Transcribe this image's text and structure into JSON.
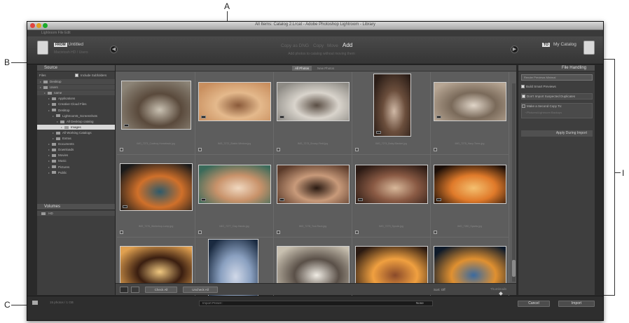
{
  "callouts": {
    "a": "A",
    "b": "B",
    "c": "C",
    "i": "I"
  },
  "window": {
    "title": "All Items: Catalog 2.Lrcat - Adobe Photoshop Lightroom - Library",
    "menu": "Lightroom   File   Edit"
  },
  "header": {
    "source_tag": "FROM",
    "source_name": "Untitled",
    "source_sub": "Macintosh HD / Users",
    "modes": [
      "Copy as DNG",
      "Copy",
      "Move",
      "Add"
    ],
    "active_mode_index": 3,
    "mode_subtitle": "Add photos to catalog without moving them",
    "dest_tag": "TO",
    "dest_name": "My Catalog"
  },
  "left_panel": {
    "header": "Source",
    "toolbar_left": "Files",
    "toolbar_right": "Include Subfolders",
    "tree": [
      {
        "label": "Desktop",
        "level": 0,
        "band": true
      },
      {
        "label": "Users",
        "level": 0,
        "band": true
      },
      {
        "label": "name",
        "level": 1,
        "band": true
      },
      {
        "label": "Applications",
        "level": 2
      },
      {
        "label": "Creative Cloud Files",
        "level": 2
      },
      {
        "label": "Desktop",
        "level": 2
      },
      {
        "label": "Lightroom5_Screenshots",
        "level": 3
      },
      {
        "label": "All Desktop catalog",
        "level": 4
      },
      {
        "label": "Images",
        "level": 5,
        "selected": true
      },
      {
        "label": "All Working Catalogs",
        "level": 3
      },
      {
        "label": "Extras",
        "level": 3
      },
      {
        "label": "Documents",
        "level": 2
      },
      {
        "label": "Downloads",
        "level": 2
      },
      {
        "label": "Movies",
        "level": 2
      },
      {
        "label": "Music",
        "level": 2
      },
      {
        "label": "Pictures",
        "level": 2
      },
      {
        "label": "Public",
        "level": 2
      }
    ],
    "footer_header": "Volumes",
    "footer_item": "HD"
  },
  "grid": {
    "tabs": [
      "All Photos",
      "New Photos"
    ],
    "active_tab_index": 0,
    "photos": [
      {
        "caption": "IMG_7271_Cowboy-Horseback.jpg",
        "colors": [
          "#8c8477",
          "#5a4a3c",
          "#c9c1b2"
        ]
      },
      {
        "caption": "IMG_7272_Stable-Window.jpg",
        "colors": [
          "#c88e5e",
          "#e4b98c",
          "#8a5a3a"
        ]
      },
      {
        "caption": "IMG_7273_Snowy-Field.jpg",
        "colors": [
          "#8d8a84",
          "#d9d4cc",
          "#5a4e44"
        ]
      },
      {
        "caption": "IMG_7274_Baby-Blanket.jpg",
        "colors": [
          "#2a1d17",
          "#6b4e3c",
          "#d0b9a6"
        ]
      },
      {
        "caption": "IMG_7275_Hazy-Trees.jpg",
        "colors": [
          "#b7a694",
          "#7a6a5a",
          "#e0d5c8"
        ]
      },
      {
        "caption": "IMG_7276_Workshop-Lamp.jpg",
        "colors": [
          "#1a1a1a",
          "#d0702a",
          "#2e5a6a"
        ]
      },
      {
        "caption": "IMG_7277_Clay-Hands.jpg",
        "colors": [
          "#3a6a5a",
          "#c8926a",
          "#f0d8c0"
        ]
      },
      {
        "caption": "IMG_7278_Tool-Rack.jpg",
        "colors": [
          "#5a3a2a",
          "#c89a7a",
          "#2a1a12"
        ]
      },
      {
        "caption": "IMG_7279_Spools.jpg",
        "colors": [
          "#2a1a14",
          "#8a5a44",
          "#d8b89a"
        ]
      },
      {
        "caption": "IMG_7280_Sparks.jpg",
        "colors": [
          "#1a0e08",
          "#e07a2a",
          "#f4c070"
        ]
      },
      {
        "caption": "IMG_7281_Workbench-Shadow.jpg",
        "colors": [
          "#e0a050",
          "#3a1e10",
          "#f0c880"
        ]
      },
      {
        "caption": "IMG_7282_Chalkboard-Heart.jpg",
        "colors": [
          "#1a2a40",
          "#8aa0c0",
          "#d0d8e8"
        ]
      },
      {
        "caption": "IMG_7283_Desk-Work.jpg",
        "colors": [
          "#c8c0b0",
          "#5a5048",
          "#f0ece4"
        ]
      },
      {
        "caption": "IMG_7284_Forge-Fire.jpg",
        "colors": [
          "#2a1a12",
          "#f0a040",
          "#8a4a2a"
        ]
      },
      {
        "caption": "IMG_7285_Blue-Flame.jpg",
        "colors": [
          "#0e1a2a",
          "#e09030",
          "#3a6aa0"
        ]
      }
    ],
    "check_all": "Check All",
    "uncheck_all": "Uncheck All",
    "sort_label": "Sort: Off",
    "thumbnails_label": "Thumbnails"
  },
  "right_panel": {
    "header": "File Handling",
    "preview_dropdown": "Render Previews  Minimal",
    "build_smart_previews": "Build Smart Previews",
    "dont_import_duplicates": "Don't Import Suspected Duplicates",
    "second_copy": "Make a Second Copy To:",
    "second_copy_path": "~/Pictures/Lightroom Backups",
    "apply_keywords": "Apply During Import"
  },
  "bottom": {
    "summary": "15 photos / 1 GB",
    "preset_label": "Import Preset :",
    "preset_value": "None",
    "cancel": "Cancel",
    "import": "Import"
  }
}
